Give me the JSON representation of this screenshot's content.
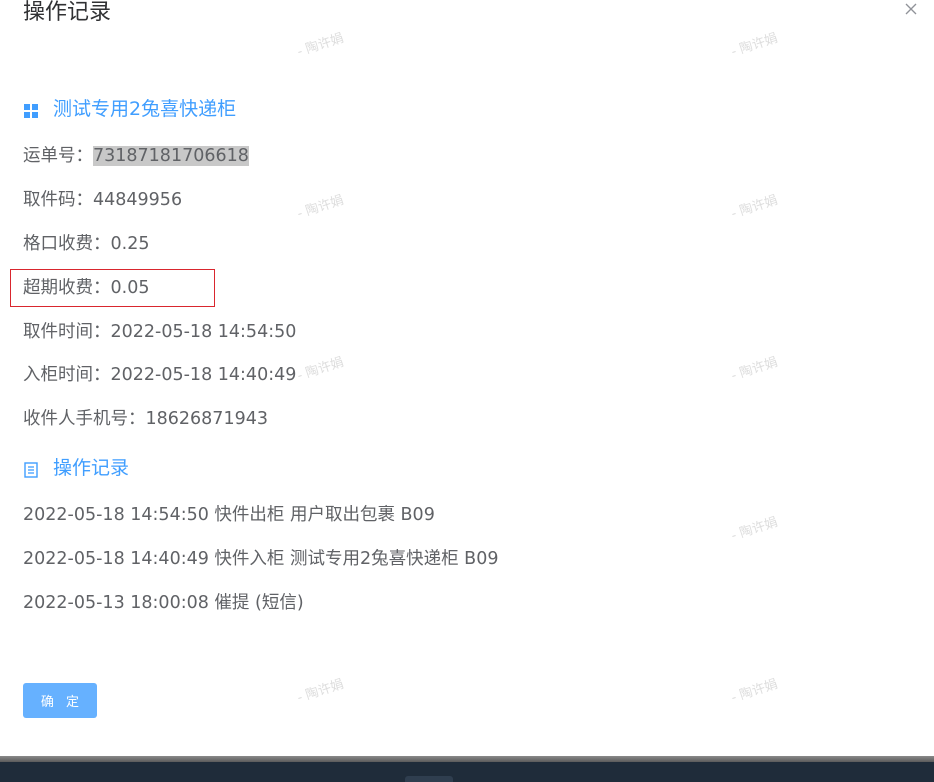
{
  "dialog": {
    "title": "操作记录",
    "close_icon": "close-icon"
  },
  "info_section": {
    "icon": "grid-icon",
    "title": "测试专用2兔喜快递柜",
    "fields": [
      {
        "label": "运单号：",
        "value": "73187181706618"
      },
      {
        "label": "取件码：",
        "value": "44849956"
      },
      {
        "label": "格口收费：",
        "value": "0.25"
      },
      {
        "label": "超期收费：",
        "value": "0.05"
      },
      {
        "label": "取件时间：",
        "value": "2022-05-18 14:54:50"
      },
      {
        "label": "入柜时间：",
        "value": "2022-05-18 14:40:49"
      },
      {
        "label": "收件人手机号：",
        "value": "18626871943"
      }
    ]
  },
  "log_section": {
    "icon": "document-icon",
    "title": "操作记录",
    "entries": [
      "2022-05-18 14:54:50 快件出柜 用户取出包裹 B09",
      "2022-05-18 14:40:49 快件入柜 测试专用2兔喜快递柜 B09",
      "2022-05-13 18:00:08 催提 (短信)"
    ]
  },
  "footer": {
    "confirm_label": "确 定"
  },
  "watermark": {
    "text": "- 陶许娟"
  },
  "colors": {
    "accent": "#409eff",
    "button": "#66b1ff",
    "highlight_box": "#d9262e"
  }
}
